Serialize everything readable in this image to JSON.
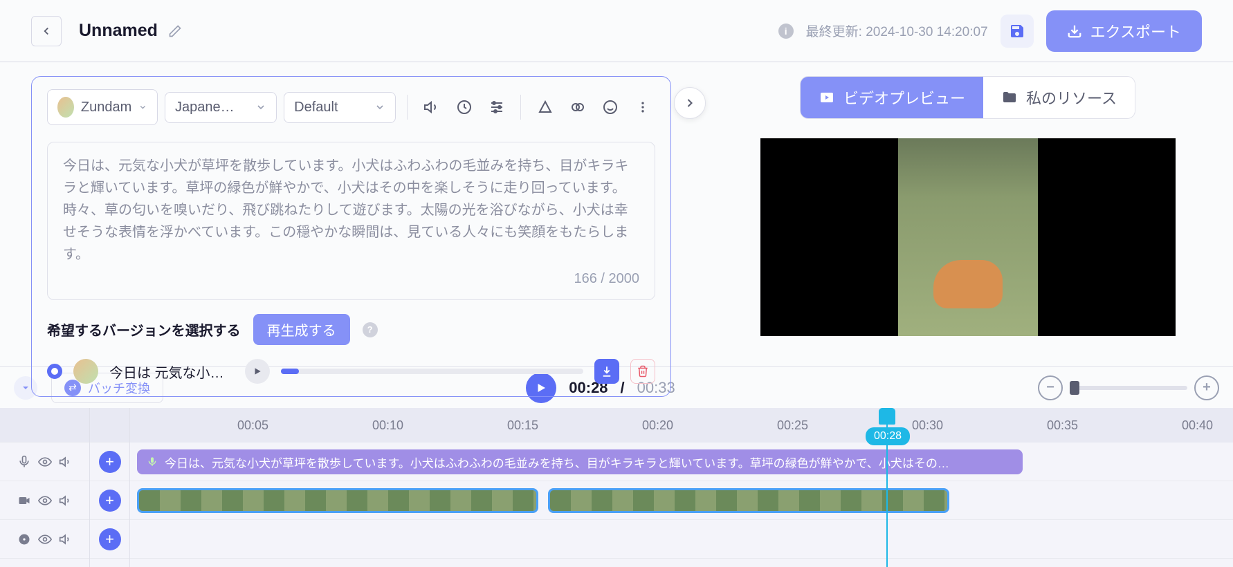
{
  "header": {
    "title": "Unnamed",
    "last_update_label": "最終更新: 2024-10-30 14:20:07",
    "export_label": "エクスポート"
  },
  "editor": {
    "voice_dropdown": "Zundam",
    "language_dropdown": "Japane…",
    "style_dropdown": "Default",
    "text": "今日は、元気な小犬が草坪を散歩しています。小犬はふわふわの毛並みを持ち、目がキラキラと輝いています。草坪の緑色が鮮やかで、小犬はその中を楽しそうに走り回っています。時々、草の匂いを嗅いだり、飛び跳ねたりして遊びます。太陽の光を浴びながら、小犬は幸せそうな表情を浮かべています。この穏やかな瞬間は、見ている人々にも笑顔をもたらします。",
    "char_count": "166 / 2000",
    "version_label": "希望するバージョンを選択する",
    "regenerate_label": "再生成する",
    "track_preview_text": "今日は 元気な小犬が…"
  },
  "right": {
    "tab_preview": "ビデオプレビュー",
    "tab_resources": "私のリソース"
  },
  "transport": {
    "batch_label": "バッチ変換",
    "current_time": "00:28",
    "separator": "/",
    "total_time": "00:33"
  },
  "timeline": {
    "ruler": [
      "00:05",
      "00:10",
      "00:15",
      "00:20",
      "00:25",
      "00:30",
      "00:35",
      "00:40"
    ],
    "playhead_label": "00:28",
    "audio_clip_text": "今日は、元気な小犬が草坪を散歩しています。小犬はふわふわの毛並みを持ち、目がキラキラと輝いています。草坪の緑色が鮮やかで、小犬はその…"
  }
}
